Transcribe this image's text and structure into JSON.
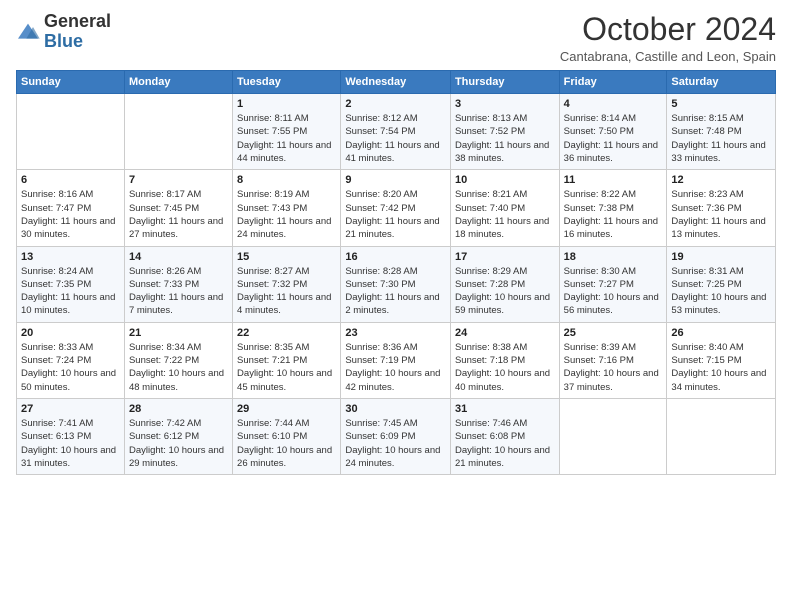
{
  "logo": {
    "general": "General",
    "blue": "Blue"
  },
  "header": {
    "month": "October 2024",
    "location": "Cantabrana, Castille and Leon, Spain"
  },
  "days_of_week": [
    "Sunday",
    "Monday",
    "Tuesday",
    "Wednesday",
    "Thursday",
    "Friday",
    "Saturday"
  ],
  "weeks": [
    [
      {
        "day": "",
        "sunrise": "",
        "sunset": "",
        "daylight": ""
      },
      {
        "day": "",
        "sunrise": "",
        "sunset": "",
        "daylight": ""
      },
      {
        "day": "1",
        "sunrise": "Sunrise: 8:11 AM",
        "sunset": "Sunset: 7:55 PM",
        "daylight": "Daylight: 11 hours and 44 minutes."
      },
      {
        "day": "2",
        "sunrise": "Sunrise: 8:12 AM",
        "sunset": "Sunset: 7:54 PM",
        "daylight": "Daylight: 11 hours and 41 minutes."
      },
      {
        "day": "3",
        "sunrise": "Sunrise: 8:13 AM",
        "sunset": "Sunset: 7:52 PM",
        "daylight": "Daylight: 11 hours and 38 minutes."
      },
      {
        "day": "4",
        "sunrise": "Sunrise: 8:14 AM",
        "sunset": "Sunset: 7:50 PM",
        "daylight": "Daylight: 11 hours and 36 minutes."
      },
      {
        "day": "5",
        "sunrise": "Sunrise: 8:15 AM",
        "sunset": "Sunset: 7:48 PM",
        "daylight": "Daylight: 11 hours and 33 minutes."
      }
    ],
    [
      {
        "day": "6",
        "sunrise": "Sunrise: 8:16 AM",
        "sunset": "Sunset: 7:47 PM",
        "daylight": "Daylight: 11 hours and 30 minutes."
      },
      {
        "day": "7",
        "sunrise": "Sunrise: 8:17 AM",
        "sunset": "Sunset: 7:45 PM",
        "daylight": "Daylight: 11 hours and 27 minutes."
      },
      {
        "day": "8",
        "sunrise": "Sunrise: 8:19 AM",
        "sunset": "Sunset: 7:43 PM",
        "daylight": "Daylight: 11 hours and 24 minutes."
      },
      {
        "day": "9",
        "sunrise": "Sunrise: 8:20 AM",
        "sunset": "Sunset: 7:42 PM",
        "daylight": "Daylight: 11 hours and 21 minutes."
      },
      {
        "day": "10",
        "sunrise": "Sunrise: 8:21 AM",
        "sunset": "Sunset: 7:40 PM",
        "daylight": "Daylight: 11 hours and 18 minutes."
      },
      {
        "day": "11",
        "sunrise": "Sunrise: 8:22 AM",
        "sunset": "Sunset: 7:38 PM",
        "daylight": "Daylight: 11 hours and 16 minutes."
      },
      {
        "day": "12",
        "sunrise": "Sunrise: 8:23 AM",
        "sunset": "Sunset: 7:36 PM",
        "daylight": "Daylight: 11 hours and 13 minutes."
      }
    ],
    [
      {
        "day": "13",
        "sunrise": "Sunrise: 8:24 AM",
        "sunset": "Sunset: 7:35 PM",
        "daylight": "Daylight: 11 hours and 10 minutes."
      },
      {
        "day": "14",
        "sunrise": "Sunrise: 8:26 AM",
        "sunset": "Sunset: 7:33 PM",
        "daylight": "Daylight: 11 hours and 7 minutes."
      },
      {
        "day": "15",
        "sunrise": "Sunrise: 8:27 AM",
        "sunset": "Sunset: 7:32 PM",
        "daylight": "Daylight: 11 hours and 4 minutes."
      },
      {
        "day": "16",
        "sunrise": "Sunrise: 8:28 AM",
        "sunset": "Sunset: 7:30 PM",
        "daylight": "Daylight: 11 hours and 2 minutes."
      },
      {
        "day": "17",
        "sunrise": "Sunrise: 8:29 AM",
        "sunset": "Sunset: 7:28 PM",
        "daylight": "Daylight: 10 hours and 59 minutes."
      },
      {
        "day": "18",
        "sunrise": "Sunrise: 8:30 AM",
        "sunset": "Sunset: 7:27 PM",
        "daylight": "Daylight: 10 hours and 56 minutes."
      },
      {
        "day": "19",
        "sunrise": "Sunrise: 8:31 AM",
        "sunset": "Sunset: 7:25 PM",
        "daylight": "Daylight: 10 hours and 53 minutes."
      }
    ],
    [
      {
        "day": "20",
        "sunrise": "Sunrise: 8:33 AM",
        "sunset": "Sunset: 7:24 PM",
        "daylight": "Daylight: 10 hours and 50 minutes."
      },
      {
        "day": "21",
        "sunrise": "Sunrise: 8:34 AM",
        "sunset": "Sunset: 7:22 PM",
        "daylight": "Daylight: 10 hours and 48 minutes."
      },
      {
        "day": "22",
        "sunrise": "Sunrise: 8:35 AM",
        "sunset": "Sunset: 7:21 PM",
        "daylight": "Daylight: 10 hours and 45 minutes."
      },
      {
        "day": "23",
        "sunrise": "Sunrise: 8:36 AM",
        "sunset": "Sunset: 7:19 PM",
        "daylight": "Daylight: 10 hours and 42 minutes."
      },
      {
        "day": "24",
        "sunrise": "Sunrise: 8:38 AM",
        "sunset": "Sunset: 7:18 PM",
        "daylight": "Daylight: 10 hours and 40 minutes."
      },
      {
        "day": "25",
        "sunrise": "Sunrise: 8:39 AM",
        "sunset": "Sunset: 7:16 PM",
        "daylight": "Daylight: 10 hours and 37 minutes."
      },
      {
        "day": "26",
        "sunrise": "Sunrise: 8:40 AM",
        "sunset": "Sunset: 7:15 PM",
        "daylight": "Daylight: 10 hours and 34 minutes."
      }
    ],
    [
      {
        "day": "27",
        "sunrise": "Sunrise: 7:41 AM",
        "sunset": "Sunset: 6:13 PM",
        "daylight": "Daylight: 10 hours and 31 minutes."
      },
      {
        "day": "28",
        "sunrise": "Sunrise: 7:42 AM",
        "sunset": "Sunset: 6:12 PM",
        "daylight": "Daylight: 10 hours and 29 minutes."
      },
      {
        "day": "29",
        "sunrise": "Sunrise: 7:44 AM",
        "sunset": "Sunset: 6:10 PM",
        "daylight": "Daylight: 10 hours and 26 minutes."
      },
      {
        "day": "30",
        "sunrise": "Sunrise: 7:45 AM",
        "sunset": "Sunset: 6:09 PM",
        "daylight": "Daylight: 10 hours and 24 minutes."
      },
      {
        "day": "31",
        "sunrise": "Sunrise: 7:46 AM",
        "sunset": "Sunset: 6:08 PM",
        "daylight": "Daylight: 10 hours and 21 minutes."
      },
      {
        "day": "",
        "sunrise": "",
        "sunset": "",
        "daylight": ""
      },
      {
        "day": "",
        "sunrise": "",
        "sunset": "",
        "daylight": ""
      }
    ]
  ]
}
